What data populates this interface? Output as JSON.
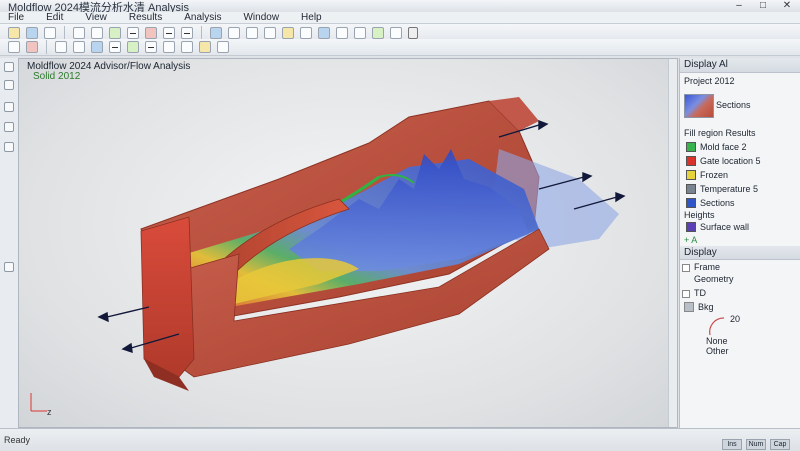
{
  "window": {
    "title": "Moldflow 2024模流分析水清 Analysis",
    "controls": [
      "–",
      "□",
      "✕"
    ]
  },
  "menu": [
    "File",
    "Edit",
    "View",
    "Results",
    "Analysis",
    "Window",
    "Help"
  ],
  "viewport": {
    "title": "Moldflow 2024 Advisor/Flow Analysis",
    "subtitle": "Solid 2012",
    "axis_label": "z"
  },
  "right_panel": {
    "header": "Display Al",
    "model_label": "Project 2012",
    "thumb_label": "Sections",
    "legend_title": "Fill region Results",
    "legend": [
      {
        "label": "Mold face 2",
        "color": "#37b24d"
      },
      {
        "label": "Gate location 5",
        "color": "#d9342b"
      },
      {
        "label": "Frozen",
        "color": "#e6d23a"
      },
      {
        "label": "Temperature 5",
        "color": "#7a8490"
      },
      {
        "label": "Sections",
        "color": "#2f55c9"
      }
    ],
    "heights_label": "Heights",
    "height_item": "Surface wall",
    "add_label": "+ A",
    "section2_header": "Display",
    "items2": [
      "Frame",
      "Geometry",
      "TD",
      "Bkg"
    ],
    "gauge_value": "20",
    "gauge_labels": [
      "None",
      "Other"
    ]
  },
  "statusbar": {
    "left": "Ready",
    "right": [
      "Ins",
      "Num",
      "Cap"
    ]
  }
}
